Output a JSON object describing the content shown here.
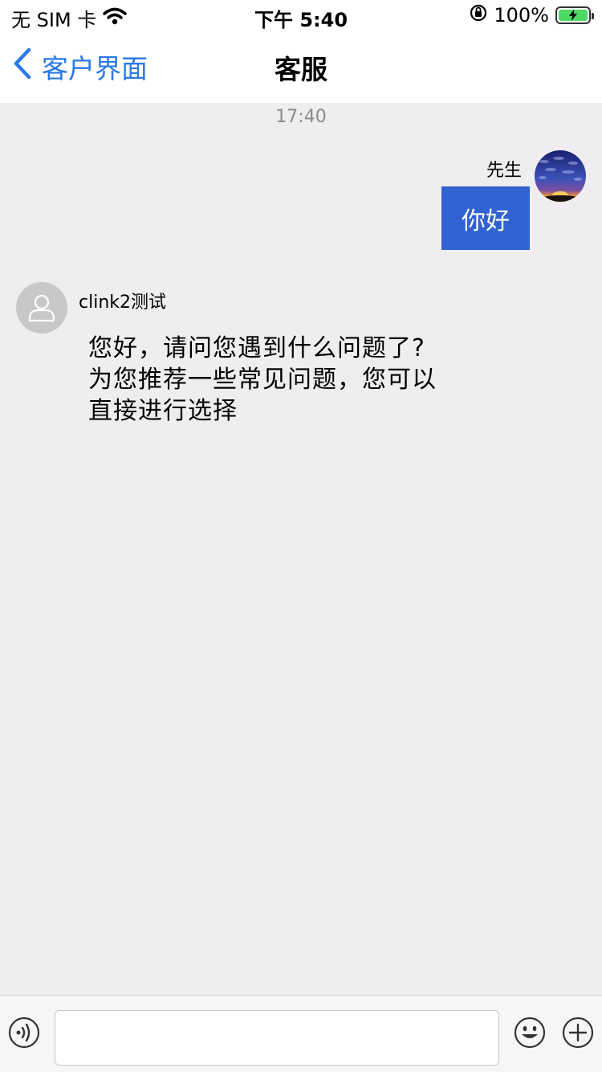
{
  "status_bar": {
    "carrier": "无 SIM 卡",
    "time": "下午 5:40",
    "battery": "100%",
    "icons": [
      "wifi-icon",
      "orientation-lock-icon",
      "battery-charging-icon"
    ]
  },
  "nav": {
    "back_label": "客户界面",
    "title": "客服"
  },
  "chat": {
    "timestamp": "17:40",
    "messages": [
      {
        "sender": "先生",
        "text": "你好",
        "side": "right"
      },
      {
        "sender": "clink2测试",
        "text": "您好，请问您遇到什么问题了?\n为您推荐一些常见问题，您可以\n直接进行选择",
        "side": "left"
      }
    ]
  },
  "input_bar": {
    "placeholder": "",
    "value": "",
    "icons": [
      "voice-icon",
      "emoji-icon",
      "plus-icon"
    ]
  },
  "colors": {
    "accent": "#2a78e8",
    "bubble": "#3162d2",
    "background": "#efedf0"
  }
}
